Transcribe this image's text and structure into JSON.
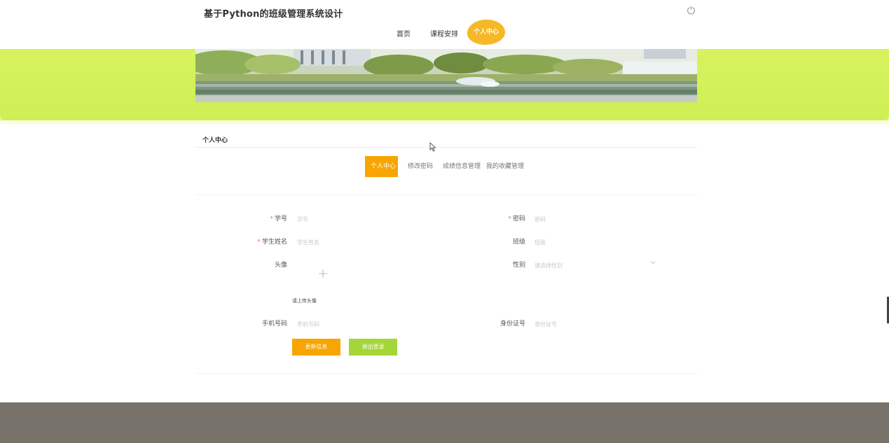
{
  "header": {
    "title": "基于Python的班级管理系统设计",
    "nav": [
      {
        "label": "首页"
      },
      {
        "label": "课程安排"
      },
      {
        "label": "个人中心"
      }
    ]
  },
  "section": {
    "title": "个人中心",
    "tabs": [
      {
        "label": "个人中心",
        "active": true
      },
      {
        "label": "修改密码"
      },
      {
        "label": "成绩信息管理"
      },
      {
        "label": "我的收藏管理"
      }
    ]
  },
  "form": {
    "student_no": {
      "label": "学号",
      "placeholder": "学号",
      "required": true
    },
    "password": {
      "label": "密码",
      "placeholder": "密码",
      "required": true
    },
    "student_name": {
      "label": "学生姓名",
      "placeholder": "学生姓名",
      "required": true
    },
    "class": {
      "label": "班级",
      "placeholder": "班级"
    },
    "avatar": {
      "label": "头像",
      "hint": "请上传头像"
    },
    "gender": {
      "label": "性别",
      "placeholder": "请选择性别"
    },
    "phone": {
      "label": "手机号码",
      "placeholder": "手机号码"
    },
    "id_card": {
      "label": "身份证号",
      "placeholder": "身份证号"
    },
    "update_button": "更新信息",
    "logout_button": "退出登录"
  },
  "colors": {
    "accent": "#f7a500",
    "banner_band": "#d4f25a",
    "logout_button": "#a4d63a",
    "footer": "#77736a"
  },
  "icons": [
    "power-icon",
    "plus-icon",
    "chevron-down-icon",
    "cursor-icon"
  ]
}
